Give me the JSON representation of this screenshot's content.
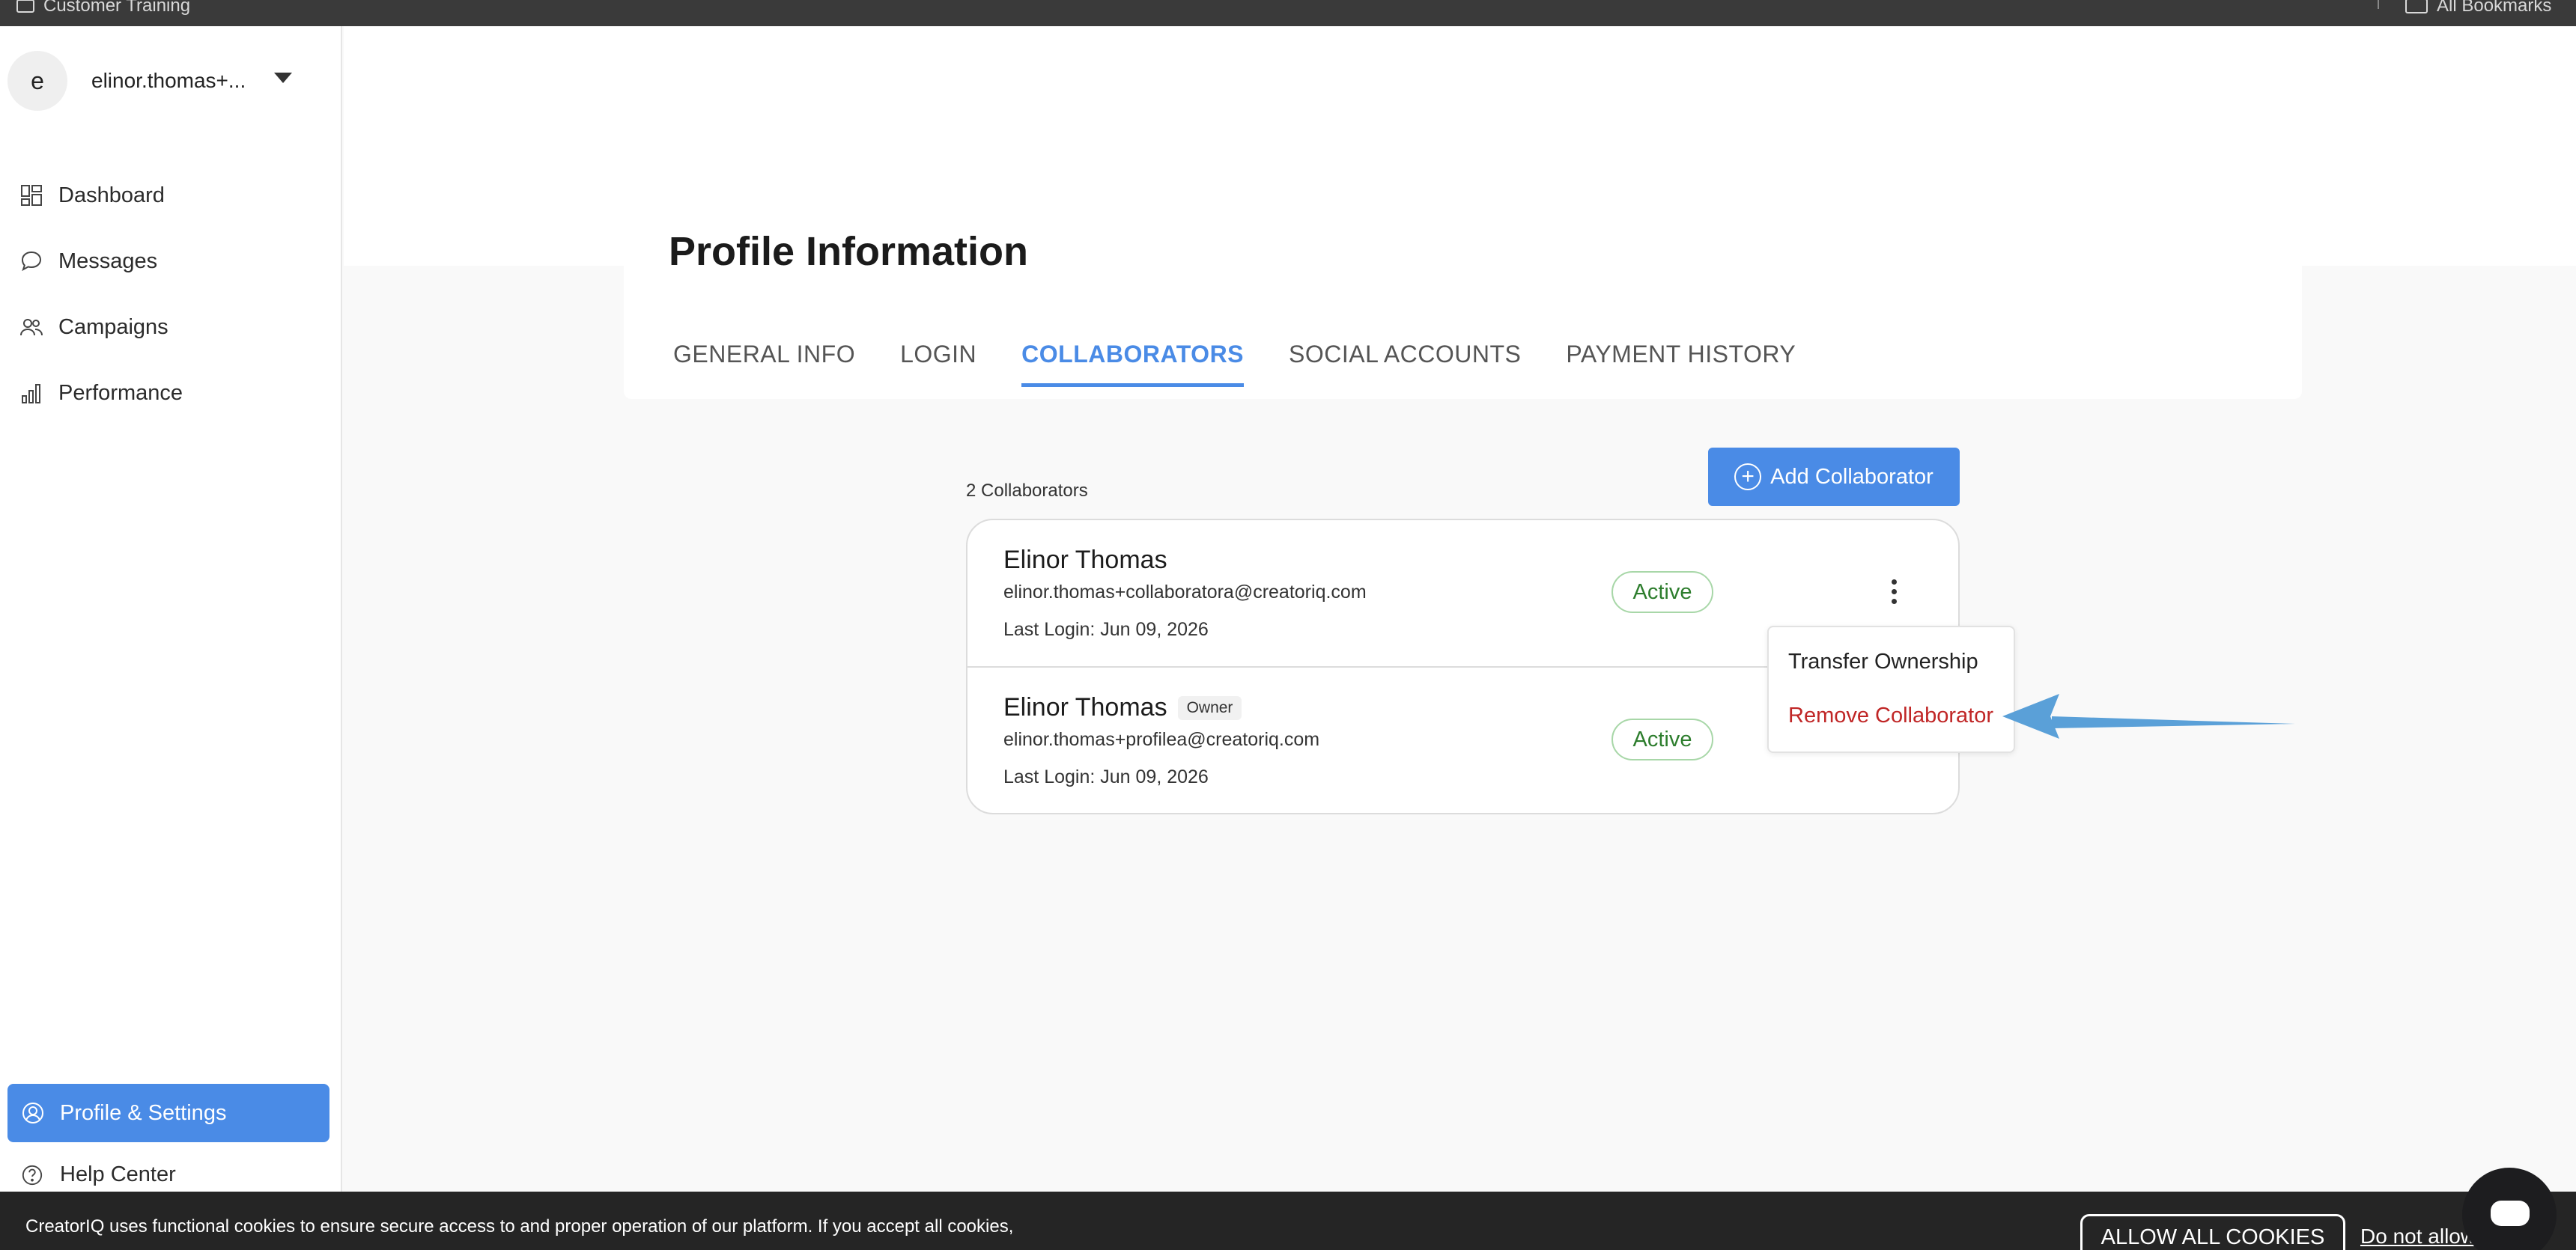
{
  "browser": {
    "bookmark_left": "Customer Training",
    "bookmark_right": "All Bookmarks"
  },
  "sidebar": {
    "avatar_initial": "e",
    "user_name": "elinor.thomas+...",
    "items": [
      {
        "label": "Dashboard",
        "icon": "grid-icon"
      },
      {
        "label": "Messages",
        "icon": "chat-bubble-icon"
      },
      {
        "label": "Campaigns",
        "icon": "people-icon"
      },
      {
        "label": "Performance",
        "icon": "bar-chart-icon"
      }
    ],
    "profile_settings": "Profile & Settings",
    "help_center": "Help Center"
  },
  "page": {
    "title": "Profile Information",
    "tabs": [
      {
        "label": "GENERAL INFO",
        "active": false
      },
      {
        "label": "LOGIN",
        "active": false
      },
      {
        "label": "COLLABORATORS",
        "active": true
      },
      {
        "label": "SOCIAL ACCOUNTS",
        "active": false
      },
      {
        "label": "PAYMENT HISTORY",
        "active": false
      }
    ]
  },
  "collaborators": {
    "count_label": "2 Collaborators",
    "add_button": "Add Collaborator",
    "rows": [
      {
        "name": "Elinor Thomas",
        "badge": "",
        "email": "elinor.thomas+collaboratora@creatoriq.com",
        "last_login": "Last Login: Jun 09, 2026",
        "status": "Active"
      },
      {
        "name": "Elinor Thomas",
        "badge": "Owner",
        "email": "elinor.thomas+profilea@creatoriq.com",
        "last_login": "Last Login: Jun 09, 2026",
        "status": "Active"
      }
    ]
  },
  "context_menu": {
    "transfer": "Transfer Ownership",
    "remove": "Remove Collaborator"
  },
  "cookie_banner": {
    "line1": "CreatorIQ uses functional cookies to ensure secure access to and proper operation of our platform. If you accept all cookies,",
    "allow_button": "ALLOW ALL COOKIES",
    "deny_link": "Do not allow"
  },
  "colors": {
    "accent": "#4a8be6",
    "danger": "#c02626",
    "success": "#2d7d2d",
    "annotation_arrow": "#5aa0d8"
  }
}
